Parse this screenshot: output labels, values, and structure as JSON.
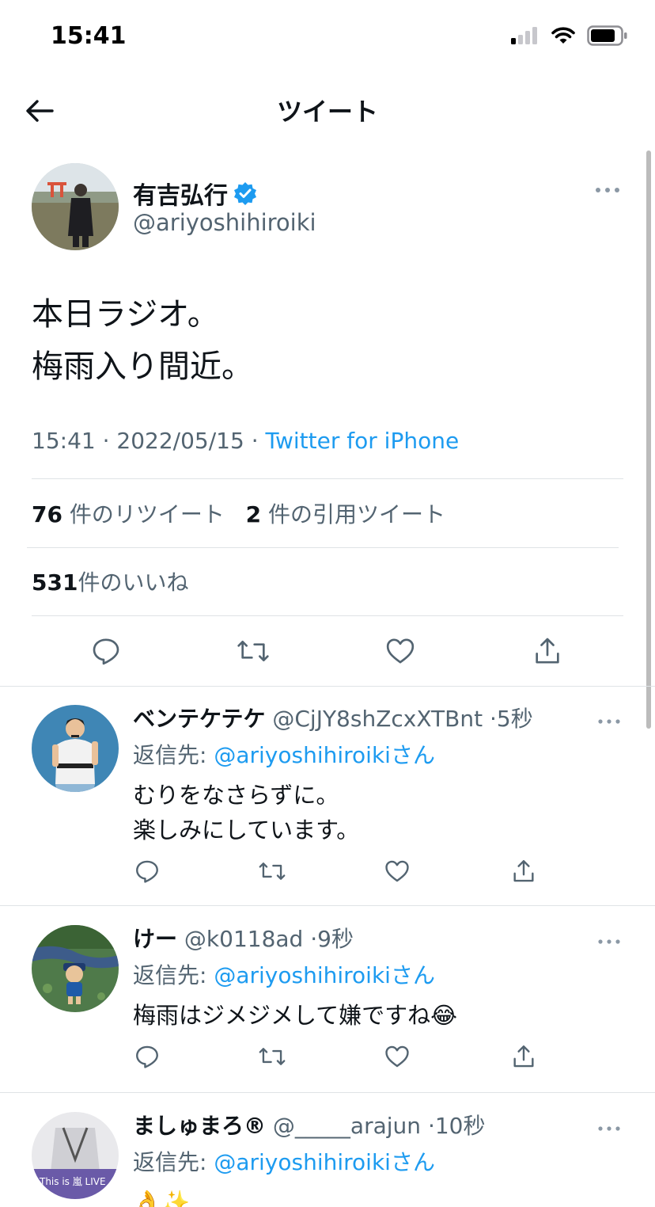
{
  "status_bar": {
    "time": "15:41"
  },
  "nav": {
    "title": "ツイート",
    "back_icon": "arrow-left-icon"
  },
  "main_tweet": {
    "author_name": "有吉弘行",
    "author_handle": "@ariyoshihiroiki",
    "verified": true,
    "body_lines": [
      "本日ラジオ。",
      "梅雨入り間近。"
    ],
    "time": "15:41",
    "date": "2022/05/15",
    "source": "Twitter for iPhone",
    "retweet_count": "76",
    "retweet_label": "件のリツイート",
    "quote_count": "2",
    "quote_label": "件の引用ツイート",
    "like_count": "531",
    "like_label": "件のいいね"
  },
  "replies": [
    {
      "name": "ベンテケテケ",
      "handle": "@CjJY8shZcxXTBnt",
      "time": "5秒",
      "reply_prefix": "返信先: ",
      "reply_mention": "@ariyoshihiroiki",
      "reply_suffix": "さん",
      "text_lines": [
        "むりをなさらずに。",
        "楽しみにしています。"
      ]
    },
    {
      "name": "けー",
      "handle": "@k0118ad",
      "time": "9秒",
      "reply_prefix": "返信先: ",
      "reply_mention": "@ariyoshihiroiki",
      "reply_suffix": "さん",
      "text_lines": [
        "梅雨はジメジメして嫌ですね😂"
      ]
    },
    {
      "name": "ましゅまろ®",
      "handle": "@_____arajun",
      "time": "10秒",
      "reply_prefix": "返信先: ",
      "reply_mention": "@ariyoshihiroiki",
      "reply_suffix": "さん",
      "text_lines": [
        "👌✨"
      ],
      "avatar_banner_text": "This is 嵐 LIVE"
    }
  ],
  "colors": {
    "accent": "#1d9bf0",
    "text": "#0f1419",
    "secondary": "#536471",
    "divider": "#dfe3e6"
  }
}
